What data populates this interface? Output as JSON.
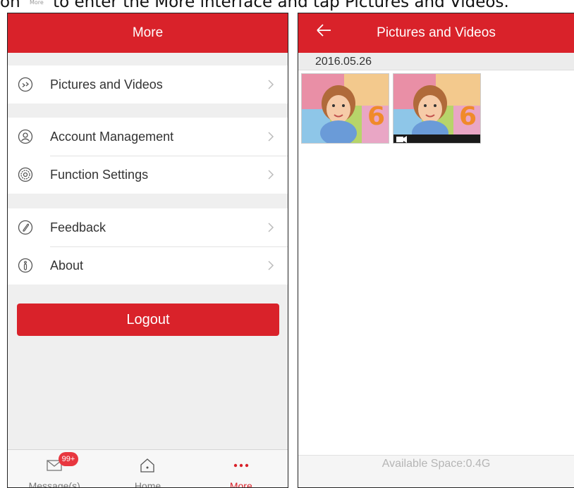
{
  "caption": {
    "prefix": "on",
    "mini_icon_label": "More",
    "text": "to enter the More interface and tap Pictures and Videos."
  },
  "more_screen": {
    "title": "More",
    "groups": [
      [
        {
          "label": "Pictures and Videos",
          "icon": "pictures-icon"
        }
      ],
      [
        {
          "label": "Account Management",
          "icon": "account-icon"
        },
        {
          "label": "Function Settings",
          "icon": "settings-icon"
        }
      ],
      [
        {
          "label": "Feedback",
          "icon": "feedback-icon"
        },
        {
          "label": "About",
          "icon": "about-icon"
        }
      ]
    ],
    "logout_label": "Logout",
    "tabs": [
      {
        "label": "Message(s)",
        "icon": "envelope-icon",
        "badge": "99+",
        "active": false
      },
      {
        "label": "Home",
        "icon": "home-icon",
        "active": false
      },
      {
        "label": "More",
        "icon": "more-dots-icon",
        "active": true
      }
    ]
  },
  "pictures_screen": {
    "title": "Pictures and Videos",
    "date": "2016.05.26",
    "items": [
      {
        "type": "picture"
      },
      {
        "type": "video"
      }
    ],
    "footer": "Available Space:0.4G"
  },
  "colors": {
    "accent": "#d9222a",
    "badge": "#e8373f",
    "background": "#efefef"
  }
}
